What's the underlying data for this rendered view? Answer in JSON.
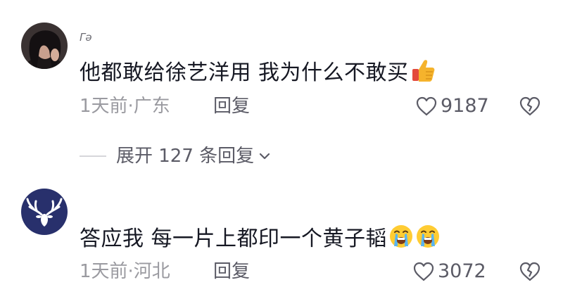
{
  "comments": [
    {
      "username": "Γə",
      "text": "他都敢给徐艺洋用 我为什么不敢买",
      "emoji": "thumbs-up",
      "time": "1天前",
      "location": "·广东",
      "reply_label": "回复",
      "likes": "9187",
      "avatar": "woman-dark-hair-photo"
    },
    {
      "username": "",
      "text": "答应我  每一片上都印一个黄子韬",
      "emoji": "loudly-crying-face",
      "time": "1天前",
      "location": "·河北",
      "reply_label": "回复",
      "likes": "3072",
      "avatar": "white-deer-on-navy"
    }
  ],
  "expand_replies": {
    "label": "展开 127 条回复"
  },
  "colors": {
    "text": "#161823",
    "meta": "#9a9aa0",
    "action": "#5b5b66",
    "navy": "#28306c"
  }
}
